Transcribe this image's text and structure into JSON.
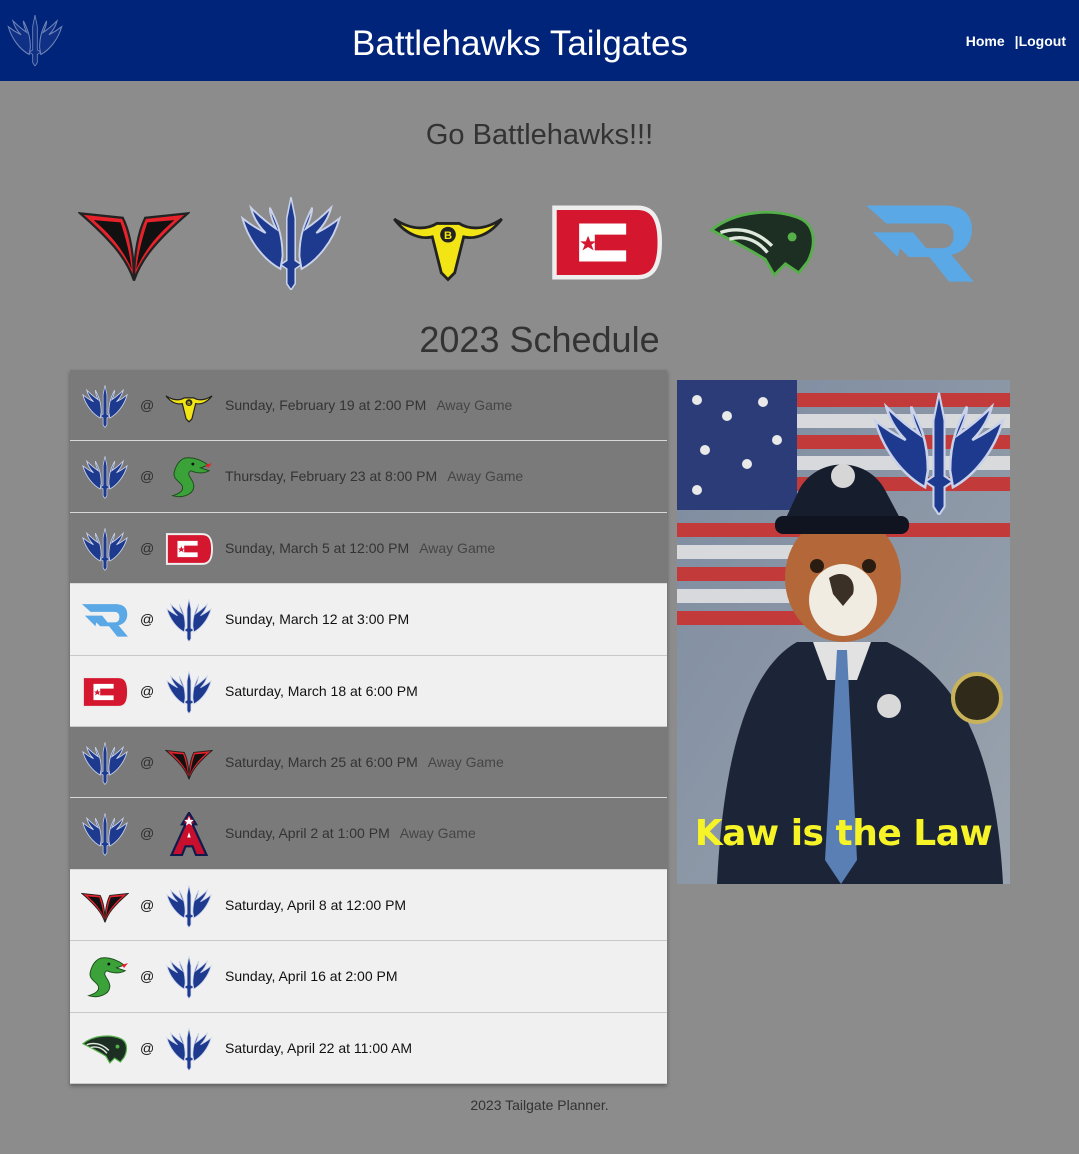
{
  "app": {
    "title": "Battlehawks Tailgates"
  },
  "nav": {
    "home_label": "Home",
    "logout_label": "|Logout"
  },
  "headings": {
    "greeting": "Go Battlehawks!!!",
    "schedule_title": "2023 Schedule"
  },
  "team_logos": [
    "vipers-logo",
    "battlehawks-logo",
    "brahmas-logo",
    "defenders-logo",
    "sea-dragons-logo",
    "roughnecks-logo"
  ],
  "schedule": [
    {
      "team1": "battlehawks",
      "team2": "brahmas",
      "at": "@",
      "date": "Sunday, February 19 at 2:00 PM",
      "tag": "Away Game",
      "away": true
    },
    {
      "team1": "battlehawks",
      "team2": "sea-dragons",
      "at": "@",
      "date": "Thursday, February 23 at 8:00 PM",
      "tag": "Away Game",
      "away": true
    },
    {
      "team1": "battlehawks",
      "team2": "defenders",
      "at": "@",
      "date": "Sunday, March 5 at 12:00 PM",
      "tag": "Away Game",
      "away": true
    },
    {
      "team1": "roughnecks",
      "team2": "battlehawks",
      "at": "@",
      "date": "Sunday, March 12 at 3:00 PM",
      "tag": "",
      "away": false
    },
    {
      "team1": "defenders",
      "team2": "battlehawks",
      "at": "@",
      "date": "Saturday, March 18 at 6:00 PM",
      "tag": "",
      "away": false
    },
    {
      "team1": "battlehawks",
      "team2": "vipers",
      "at": "@",
      "date": "Saturday, March 25 at 6:00 PM",
      "tag": "Away Game",
      "away": true
    },
    {
      "team1": "battlehawks",
      "team2": "renegades",
      "at": "@",
      "date": "Sunday, April 2 at 1:00 PM",
      "tag": "Away Game",
      "away": true
    },
    {
      "team1": "vipers",
      "team2": "battlehawks",
      "at": "@",
      "date": "Saturday, April 8 at 12:00 PM",
      "tag": "",
      "away": false
    },
    {
      "team1": "sea-dragons",
      "team2": "battlehawks",
      "at": "@",
      "date": "Sunday, April 16 at 2:00 PM",
      "tag": "",
      "away": false
    },
    {
      "team1": "guardians",
      "team2": "battlehawks",
      "at": "@",
      "date": "Saturday, April 22 at 11:00 AM",
      "tag": "",
      "away": false
    }
  ],
  "mascot": {
    "caption": "Kaw is the Law"
  },
  "footer": {
    "text": "2023 Tailgate Planner."
  },
  "colors": {
    "navbar": "#002479",
    "page_bg": "#8c8c8c",
    "away_row": "#7a7a7a",
    "home_row": "#f0f0f0",
    "caption": "#f6f327"
  }
}
